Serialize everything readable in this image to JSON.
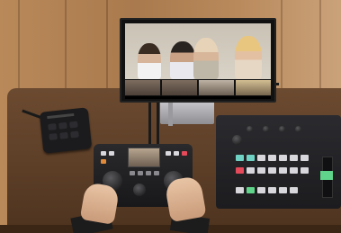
{
  "scene": {
    "monitor_thumbnail_labels": [],
    "device_brand_text": ""
  }
}
